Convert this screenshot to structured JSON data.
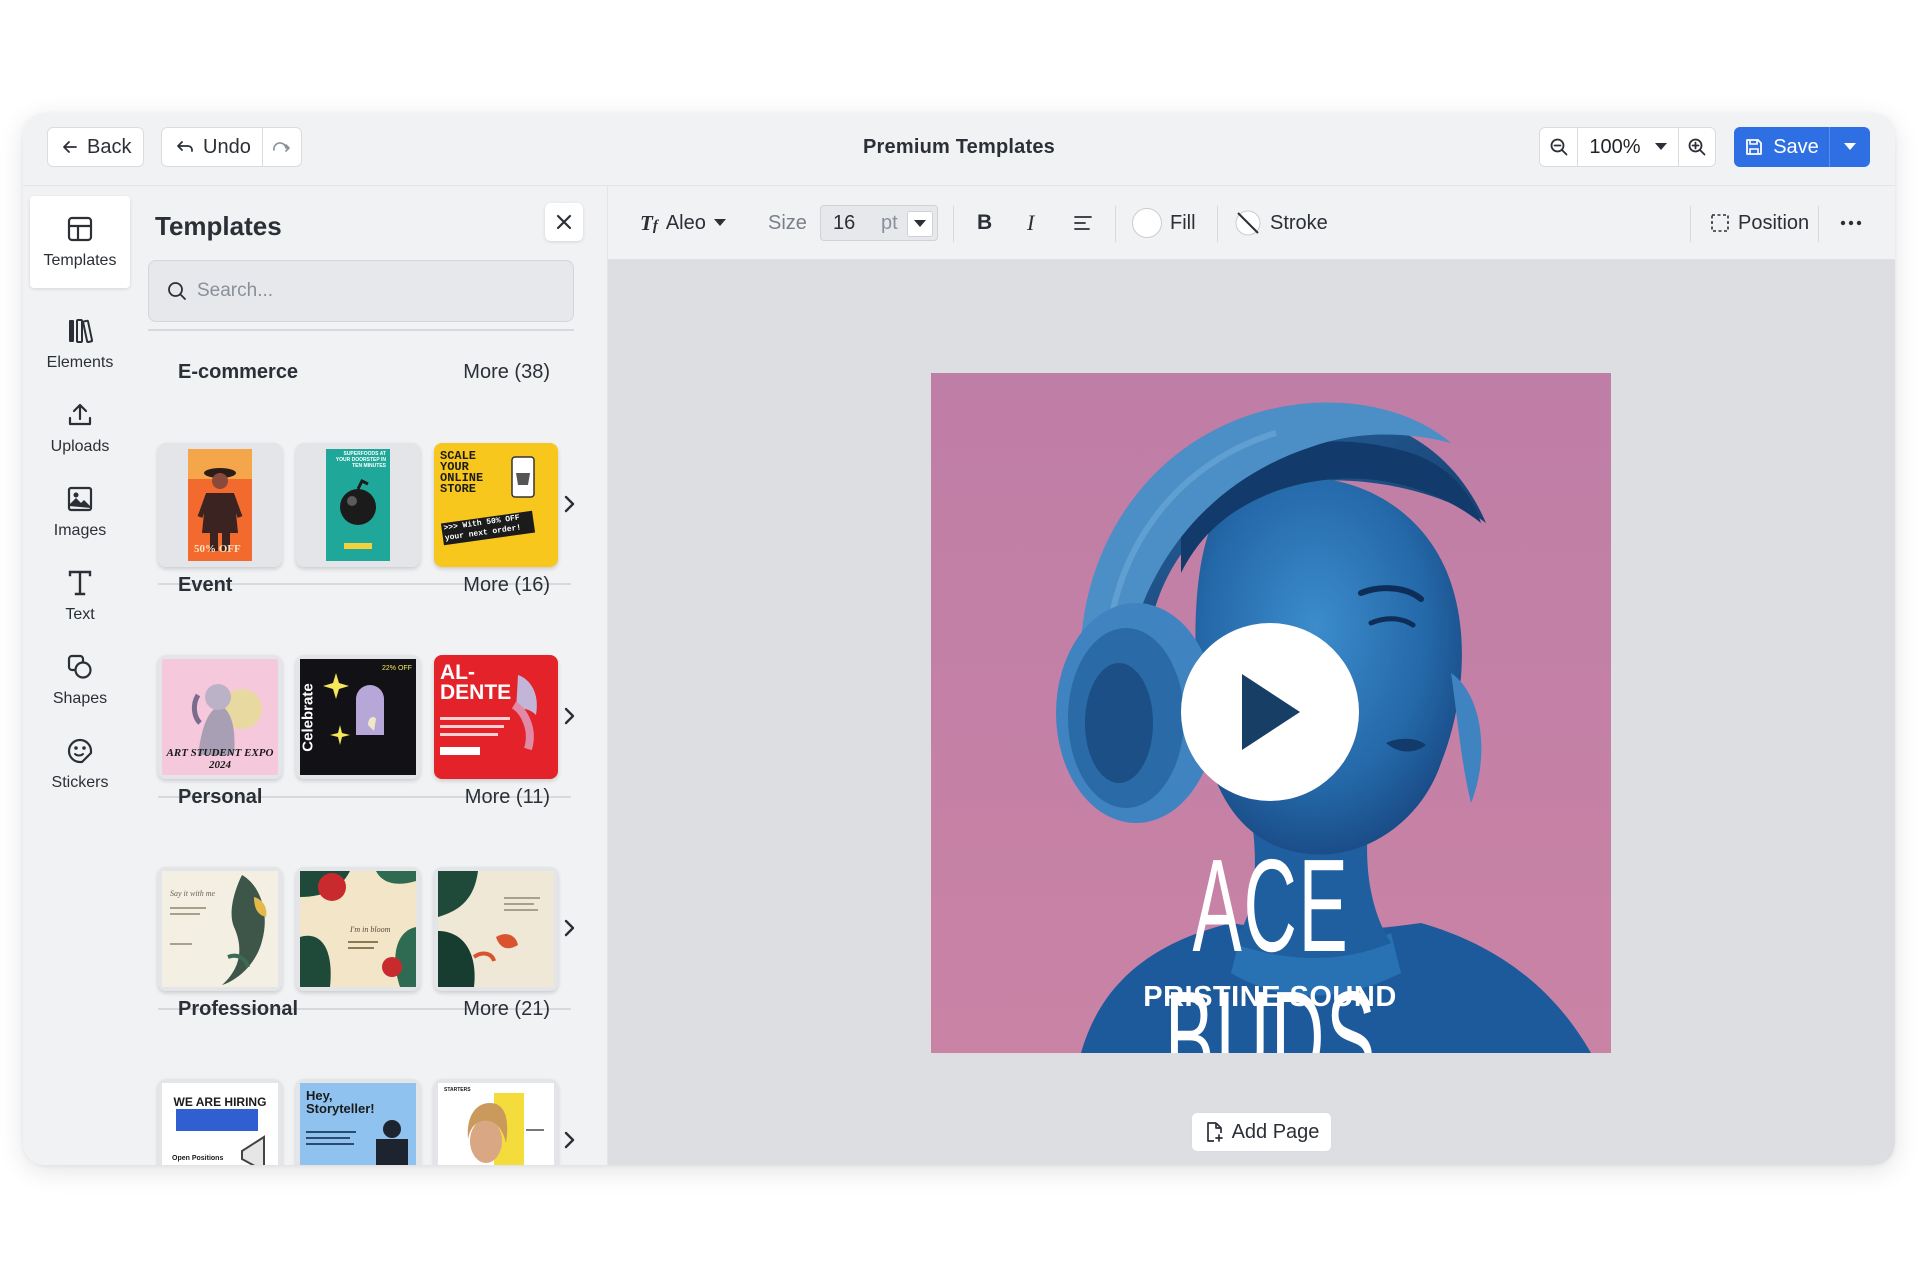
{
  "topbar": {
    "back_label": "Back",
    "undo_label": "Undo",
    "title": "Premium Templates",
    "zoom": "100%",
    "save_label": "Save"
  },
  "rail": {
    "items": [
      {
        "label": "Templates",
        "icon": "layout-icon",
        "active": true
      },
      {
        "label": "Elements",
        "icon": "elements-icon"
      },
      {
        "label": "Uploads",
        "icon": "upload-icon"
      },
      {
        "label": "Images",
        "icon": "image-icon"
      },
      {
        "label": "Text",
        "icon": "text-icon"
      },
      {
        "label": "Shapes",
        "icon": "shapes-icon"
      },
      {
        "label": "Stickers",
        "icon": "sticker-icon"
      }
    ]
  },
  "panel": {
    "title": "Templates",
    "search_placeholder": "Search...",
    "categories": [
      {
        "label": "E-commerce",
        "more": "More (38)",
        "thumb_texts": [
          "50% OFF",
          "SUPERFOODS AT YOUR DOORSTEP IN TEN MINUTES",
          "SCALE YOUR ONLINE STORE",
          ">>> With 50% OFF your next order!"
        ]
      },
      {
        "label": "Event",
        "more": "More (16)",
        "thumb_texts": [
          "ART STUDENT EXPO 2024",
          "Celebrate",
          "22% OFF",
          "AL-DENTE"
        ]
      },
      {
        "label": "Personal",
        "more": "More (11)",
        "thumb_texts": [
          "Say it with me",
          "I'm in bloom"
        ]
      },
      {
        "label": "Professional",
        "more": "More (21)",
        "thumb_texts": [
          "WE ARE HIRING",
          "Open Positions",
          "Hey, Storyteller!",
          "STARTERS"
        ]
      }
    ]
  },
  "toolbar": {
    "font": "Aleo",
    "size_label": "Size",
    "size_value": "16",
    "size_unit": "pt",
    "fill_label": "Fill",
    "stroke_label": "Stroke",
    "position_label": "Position"
  },
  "canvas": {
    "headline": "ACE BUDS",
    "subline": "PRISTINE SOUND",
    "add_page_label": "Add Page"
  },
  "colors": {
    "accent": "#2f6fe4",
    "artboard_pink": "#c47aa0",
    "figure_blue": "#2b76b0"
  }
}
